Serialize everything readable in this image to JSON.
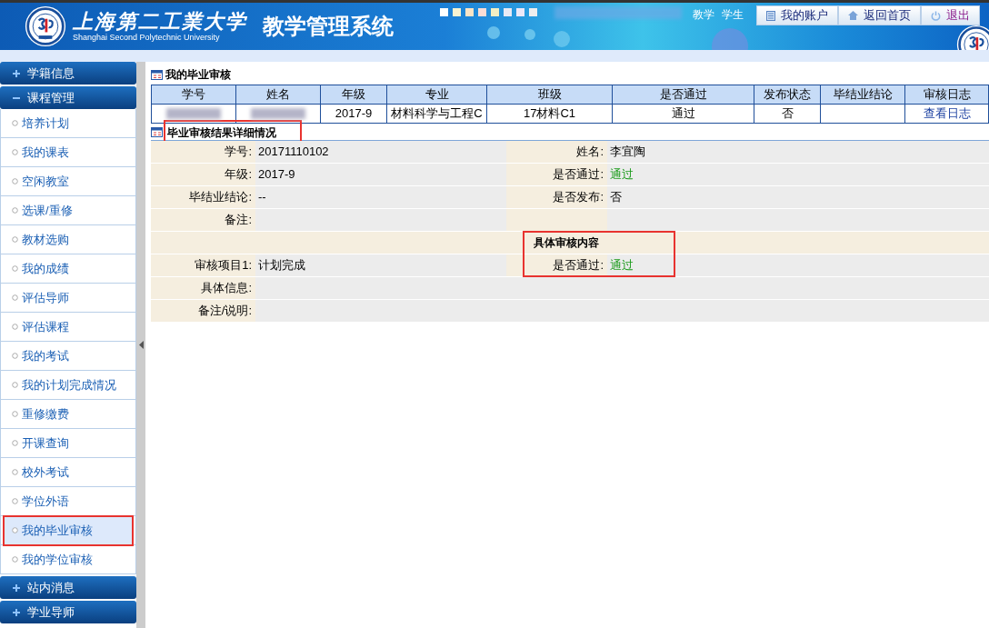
{
  "header": {
    "school_name": "上海第二工業大学",
    "school_name_en": "Shanghai Second Polytechnic University",
    "system_title": "教学管理系统",
    "roles": [
      "教学",
      "学生"
    ],
    "buttons": [
      {
        "label": "我的账户",
        "kind": "account"
      },
      {
        "label": "返回首页",
        "kind": "home"
      },
      {
        "label": "退出",
        "kind": "logout"
      }
    ]
  },
  "sidebar": {
    "groups": [
      {
        "label": "学籍信息",
        "expanded": false
      },
      {
        "label": "课程管理",
        "expanded": true,
        "items": [
          {
            "label": "培养计划",
            "selected": false,
            "highlighted": false
          },
          {
            "label": "我的课表",
            "selected": false,
            "highlighted": false
          },
          {
            "label": "空闲教室",
            "selected": false,
            "highlighted": false
          },
          {
            "label": "选课/重修",
            "selected": false,
            "highlighted": false
          },
          {
            "label": "教材选购",
            "selected": false,
            "highlighted": false
          },
          {
            "label": "我的成绩",
            "selected": false,
            "highlighted": false
          },
          {
            "label": "评估导师",
            "selected": false,
            "highlighted": false
          },
          {
            "label": "评估课程",
            "selected": false,
            "highlighted": false
          },
          {
            "label": "我的考试",
            "selected": false,
            "highlighted": false
          },
          {
            "label": "我的计划完成情况",
            "selected": false,
            "highlighted": false
          },
          {
            "label": "重修缴费",
            "selected": false,
            "highlighted": false
          },
          {
            "label": "开课查询",
            "selected": false,
            "highlighted": false
          },
          {
            "label": "校外考试",
            "selected": false,
            "highlighted": false
          },
          {
            "label": "学位外语",
            "selected": false,
            "highlighted": false
          },
          {
            "label": "我的毕业审核",
            "selected": true,
            "highlighted": true
          },
          {
            "label": "我的学位审核",
            "selected": false,
            "highlighted": false
          }
        ]
      },
      {
        "label": "站内消息",
        "expanded": false
      },
      {
        "label": "学业导师",
        "expanded": false
      }
    ]
  },
  "summary": {
    "title": "我的毕业审核",
    "columns": [
      "学号",
      "姓名",
      "年级",
      "专业",
      "班级",
      "是否通过",
      "发布状态",
      "毕结业结论",
      "审核日志"
    ],
    "rows": [
      {
        "cells": [
          {
            "blurred": true
          },
          {
            "blurred": true
          },
          {
            "text": "2017-9"
          },
          {
            "text": "材料科学与工程C"
          },
          {
            "text": "17材料C1"
          },
          {
            "text": "通过"
          },
          {
            "text": "否"
          },
          {},
          {
            "text": "查看日志",
            "kind": "link"
          }
        ]
      }
    ]
  },
  "detail": {
    "title": "毕业审核结果详细情况",
    "title_highlighted": true,
    "rows": [
      {
        "kind": "pair",
        "fields": [
          {
            "label": "学号:",
            "value": "20171110102"
          },
          {
            "label": "姓名:",
            "value": "李宜陶"
          }
        ]
      },
      {
        "kind": "pair",
        "fields": [
          {
            "label": "年级:",
            "value": "2017-9"
          },
          {
            "label": "是否通过:",
            "value": "通过",
            "kind": "status"
          }
        ]
      },
      {
        "kind": "pair",
        "fields": [
          {
            "label": "毕结业结论:",
            "value": "--"
          },
          {
            "label": "是否发布:",
            "value": "否"
          }
        ]
      },
      {
        "kind": "pair",
        "fields": [
          {
            "label": "备注:"
          }
        ]
      },
      {
        "kind": "section",
        "title": "具体审核内容",
        "highlighted": true
      },
      {
        "kind": "pair",
        "fields": [
          {
            "label": "审核项目1:",
            "value": "计划完成"
          },
          {
            "label": "是否通过:",
            "value": "通过",
            "kind": "status"
          }
        ]
      },
      {
        "kind": "full",
        "fields": [
          {
            "label": "具体信息:"
          }
        ]
      },
      {
        "kind": "full",
        "fields": [
          {
            "label": "备注/说明:"
          }
        ]
      }
    ]
  }
}
